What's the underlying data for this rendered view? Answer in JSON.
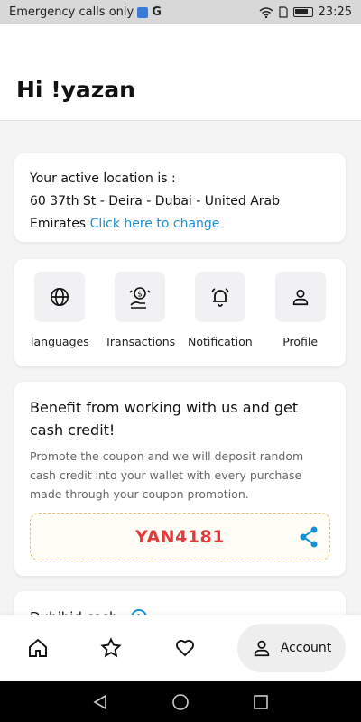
{
  "status_bar": {
    "carrier_text": "Emergency calls only",
    "time": "23:25"
  },
  "header": {
    "greeting": "Hi !yazan"
  },
  "location_card": {
    "line1": "Your active location is :",
    "line2": "60 37th St - Deira - Dubai - United Arab",
    "line3": "Emirates",
    "change_link": "Click here to change"
  },
  "quick_actions": [
    {
      "label": "languages",
      "icon": "globe-icon"
    },
    {
      "label": "Transactions",
      "icon": "money-hand-icon"
    },
    {
      "label": "Notification",
      "icon": "bell-ringing-icon"
    },
    {
      "label": "Profile",
      "icon": "person-icon"
    }
  ],
  "promo_card": {
    "title": "Benefit from working with us and get cash credit!",
    "description": "Promote the coupon and we will deposit random cash credit into your wallet with every purchase made through your coupon promotion.",
    "coupon_code": "YAN4181",
    "share_icon": "share-icon"
  },
  "next_card": {
    "title": "Dubibid cash"
  },
  "bottom_nav": {
    "items": [
      "home-icon",
      "star-icon",
      "heart-icon"
    ],
    "account_label": "Account"
  },
  "colors": {
    "link": "#1a8fd1",
    "coupon_text": "#e23a3a",
    "coupon_border": "#e6c066"
  }
}
